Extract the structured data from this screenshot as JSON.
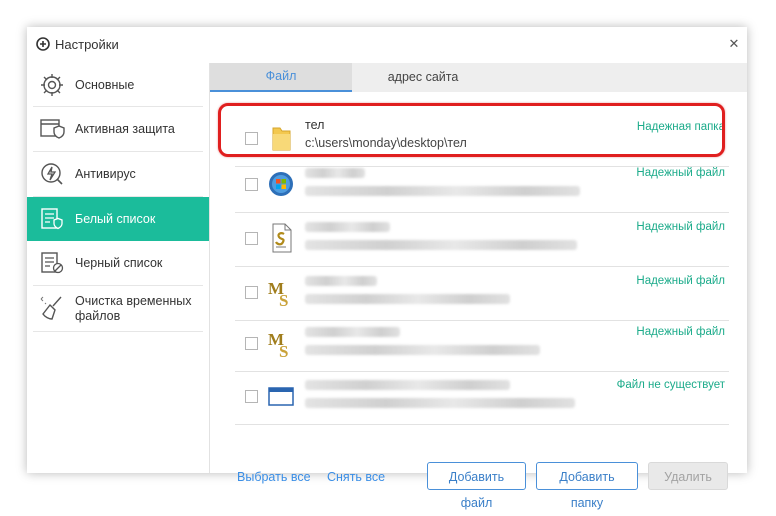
{
  "window": {
    "title": "Настройки"
  },
  "sidebar": {
    "items": [
      {
        "label": "Основные",
        "icon": "gear-icon"
      },
      {
        "label": "Активная защита",
        "icon": "shield-window-icon"
      },
      {
        "label": "Антивирус",
        "icon": "lightning-scan-icon"
      },
      {
        "label": "Белый список",
        "icon": "whitelist-icon",
        "active": true
      },
      {
        "label": "Черный список",
        "icon": "blacklist-icon"
      },
      {
        "label": "Очистка временных файлов",
        "icon": "broom-icon"
      }
    ]
  },
  "tabs": [
    {
      "label": "Файл",
      "active": true
    },
    {
      "label": "адрес сайта",
      "active": false
    }
  ],
  "list": {
    "rows": [
      {
        "name": "тел",
        "path": "c:\\users\\monday\\desktop\\тел",
        "status": "Надежная папка",
        "icon": "folder-icon"
      },
      {
        "name": "",
        "path": "",
        "status": "Надежный файл",
        "icon": "windows-app-icon"
      },
      {
        "name": "",
        "path": "",
        "status": "Надежный файл",
        "icon": "script-file-icon"
      },
      {
        "name": "",
        "path": "",
        "status": "Надежный файл",
        "icon": "ms-document-icon"
      },
      {
        "name": "",
        "path": "",
        "status": "Надежный файл",
        "icon": "ms-document-icon"
      },
      {
        "name": "",
        "path": "",
        "status": "Файл не существует",
        "icon": "window-icon"
      }
    ]
  },
  "footer": {
    "select_all": "Выбрать все",
    "deselect_all": "Снять все",
    "add_file": "Добавить файл",
    "add_folder": "Добавить папку",
    "delete": "Удалить"
  },
  "colors": {
    "accent": "#1bbc9b",
    "link": "#3a8ee6",
    "status": "#1bab8a",
    "highlight": "#e01f1f"
  }
}
